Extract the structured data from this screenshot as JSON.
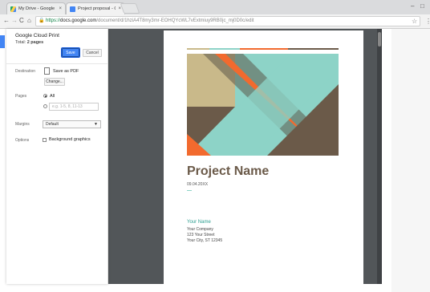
{
  "browser": {
    "tabs": [
      {
        "title": "My Drive - Google Drive",
        "close": "×"
      },
      {
        "title": "Project proposal - Goo",
        "close": "×"
      }
    ],
    "window_controls": {
      "minimize": "–",
      "maximize": "□"
    },
    "nav": {
      "back": "←",
      "forward": "→",
      "reload": "C",
      "home": "⌂"
    },
    "url": {
      "scheme": "https://",
      "host": "docs.google.com",
      "path": "/document/d/1hziA4T8my3mr-EOHQYcWL7vExtmiuy9RB0jc_mj0D0c/edit"
    },
    "star": "☆",
    "menu": "⋮"
  },
  "print_panel": {
    "title": "Google Cloud Print",
    "total_label": "Total:",
    "total_value": "2 pages",
    "save_label": "Save",
    "cancel_label": "Cancel",
    "destination_label": "Destination",
    "destination_value": "Save as PDF",
    "change_label": "Change...",
    "pages_label": "Pages",
    "pages_all": "All",
    "pages_placeholder": "e.g. 1-5, 8, 11-13",
    "margins_label": "Margins",
    "margins_value": "Default",
    "options_label": "Options",
    "background_graphics": "Background graphics"
  },
  "preview": {
    "title": "Project Name",
    "date": "09.04.20XX",
    "your_name": "Your Name",
    "company": "Your Company",
    "street": "123 Your Street",
    "city": "Your City, ST 12345"
  },
  "colors": {
    "accent": "#4285f4",
    "title": "#6b5a49",
    "teal": "#2a9d8f",
    "orange": "#f26a2e",
    "tan": "#c9b98a",
    "mint": "#8dd3c7",
    "brown": "#6b5a49"
  }
}
